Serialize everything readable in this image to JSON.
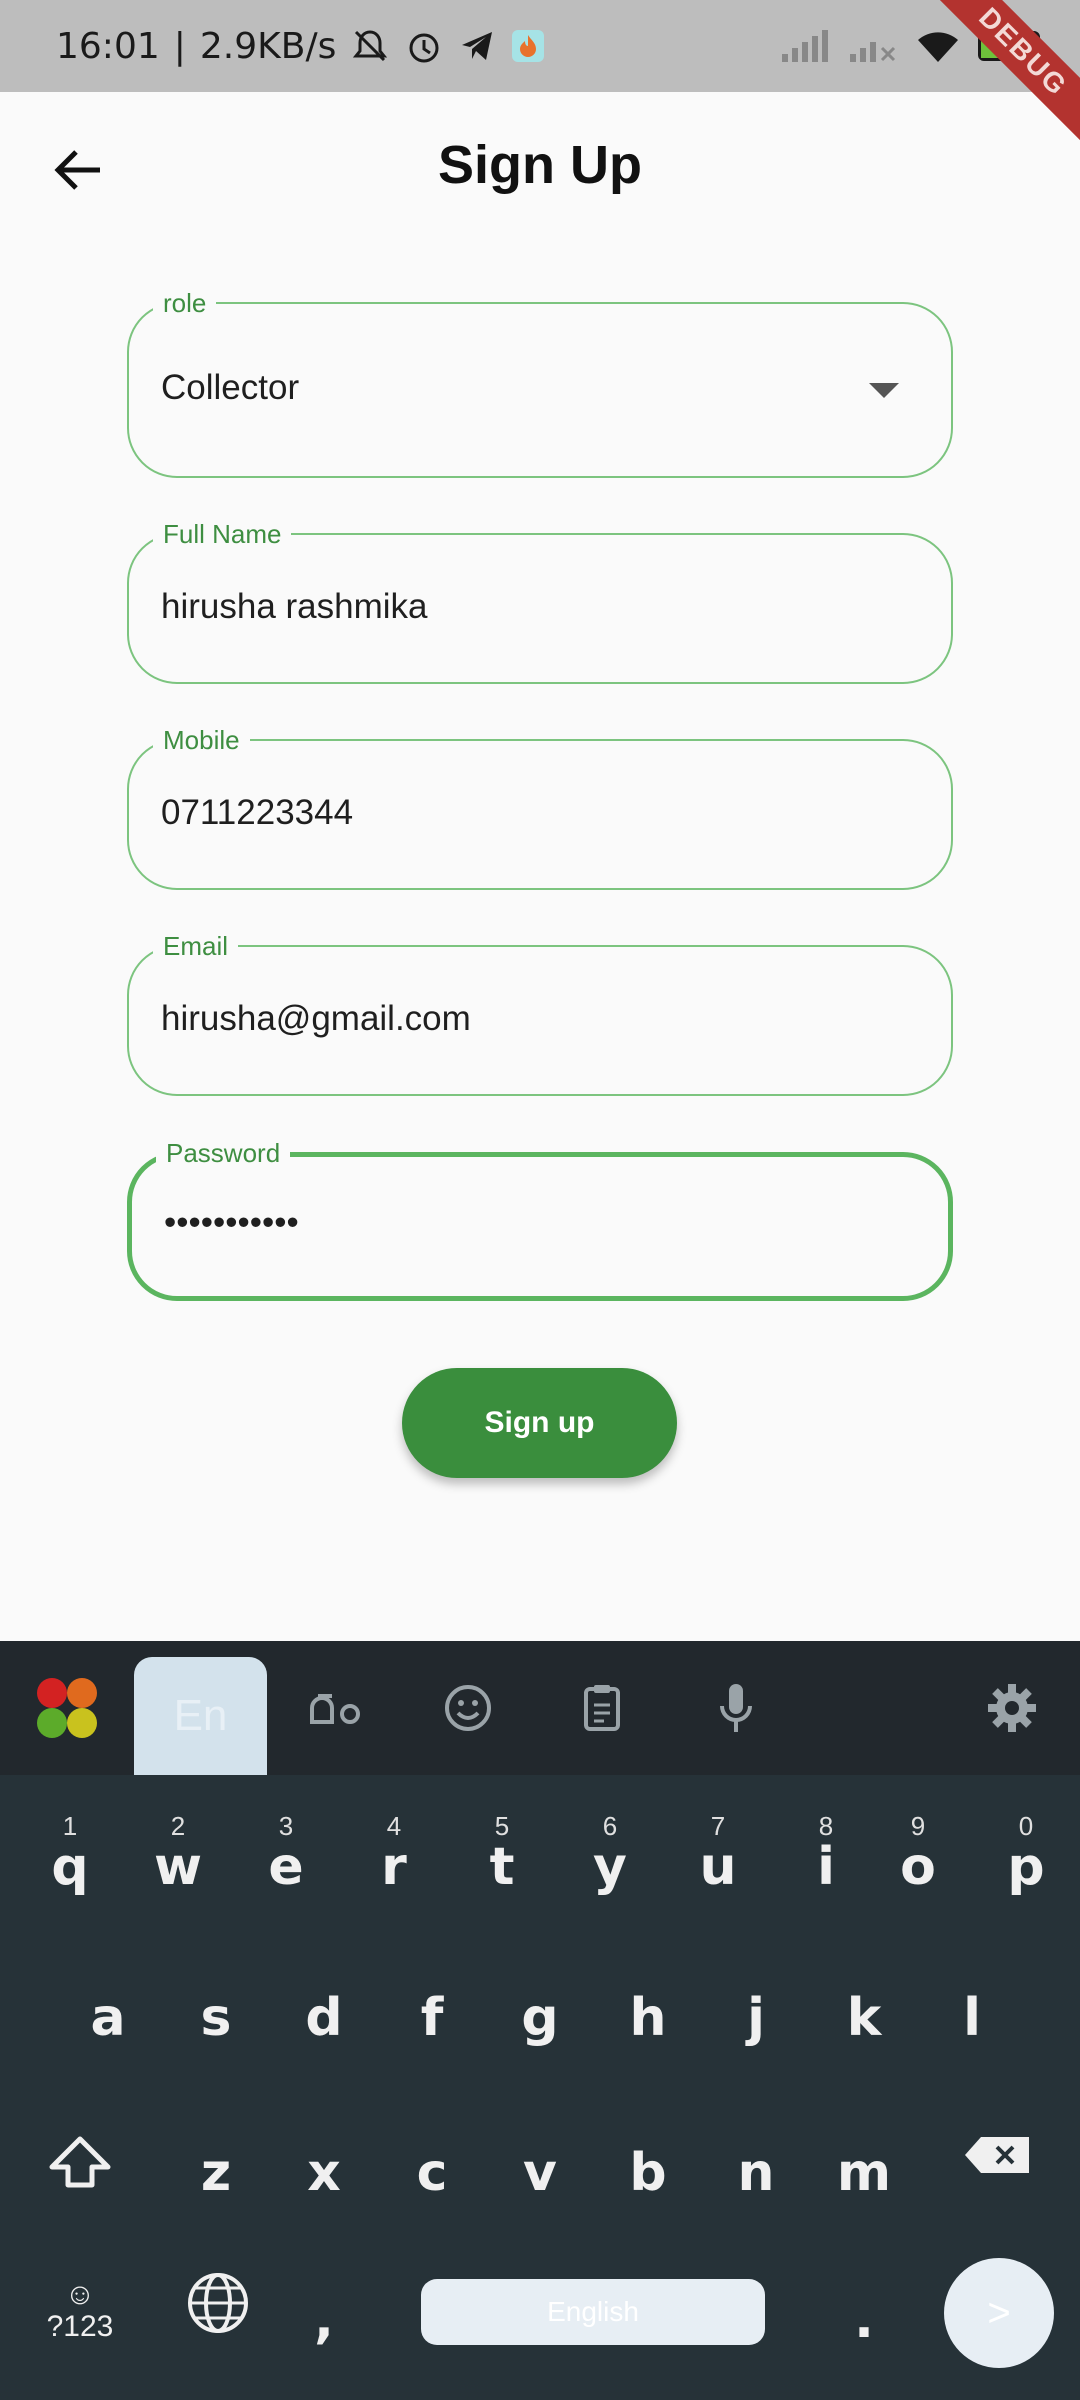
{
  "status_bar": {
    "time": "16:01",
    "speed": "2.9KB/s",
    "battery": "49",
    "debug_label": "DEBUG"
  },
  "app_bar": {
    "title": "Sign Up"
  },
  "form": {
    "role": {
      "label": "role",
      "value": "Collector"
    },
    "full_name": {
      "label": "Full Name",
      "value": "hirusha rashmika"
    },
    "mobile": {
      "label": "Mobile",
      "value": "0711223344"
    },
    "email": {
      "label": "Email",
      "value": "hirusha@gmail.com"
    },
    "password": {
      "label": "Password",
      "value": "•••••••••••"
    },
    "submit_label": "Sign up"
  },
  "keyboard": {
    "lang_tab": "En",
    "space_label": "English",
    "sym_label": "?123",
    "comma": ",",
    "period": ".",
    "enter_label": ">",
    "row1": [
      {
        "num": "1",
        "ch": "q"
      },
      {
        "num": "2",
        "ch": "w"
      },
      {
        "num": "3",
        "ch": "e"
      },
      {
        "num": "4",
        "ch": "r"
      },
      {
        "num": "5",
        "ch": "t"
      },
      {
        "num": "6",
        "ch": "y"
      },
      {
        "num": "7",
        "ch": "u"
      },
      {
        "num": "8",
        "ch": "i"
      },
      {
        "num": "9",
        "ch": "o"
      },
      {
        "num": "0",
        "ch": "p"
      }
    ],
    "row2": [
      "a",
      "s",
      "d",
      "f",
      "g",
      "h",
      "j",
      "k",
      "l"
    ],
    "row3": [
      "z",
      "x",
      "c",
      "v",
      "b",
      "n",
      "m"
    ]
  }
}
